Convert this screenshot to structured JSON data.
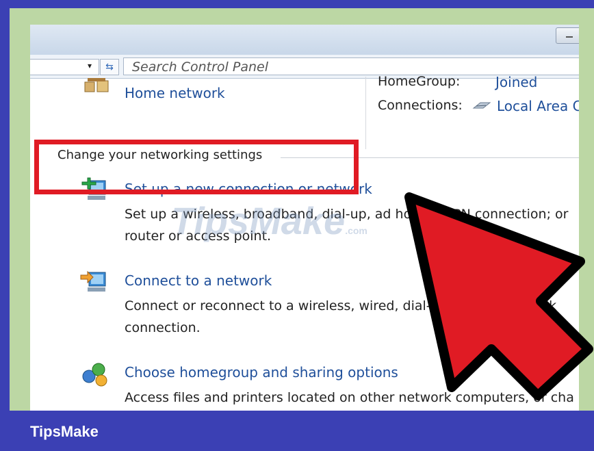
{
  "window": {
    "search_placeholder": "Search Control Panel"
  },
  "network_info": {
    "network_name": "Home network",
    "homegroup_label": "HomeGroup:",
    "homegroup_value": "Joined",
    "connections_label": "Connections:",
    "connections_value": "Local Area C"
  },
  "settings": {
    "heading": "Change your networking settings",
    "items": [
      {
        "title": "Set up a new connection or network",
        "desc_line1": "Set up a wireless, broadband, dial-up, ad hoc, or VPN connection; or",
        "desc_line2": "router or access point."
      },
      {
        "title": "Connect to a network",
        "desc_line1": "Connect or reconnect to a wireless, wired, dial-up, or VPN network",
        "desc_line2": "connection."
      },
      {
        "title": "Choose homegroup and sharing options",
        "desc_line1": "Access files and printers located on other network computers, or cha"
      }
    ]
  },
  "watermark": {
    "text": "TipsMake",
    "suffix": ".com"
  },
  "footer": {
    "brand": "TipsMake"
  },
  "colors": {
    "frame": "#3b40b4",
    "highlight": "#e01b24",
    "link": "#1f4f9a",
    "arrow": "#e01b24"
  },
  "icons": [
    "refresh-icon",
    "dropdown-arrow-icon",
    "home-network-icon",
    "new-connection-icon",
    "connect-network-icon",
    "homegroup-icon",
    "network-cable-icon"
  ]
}
